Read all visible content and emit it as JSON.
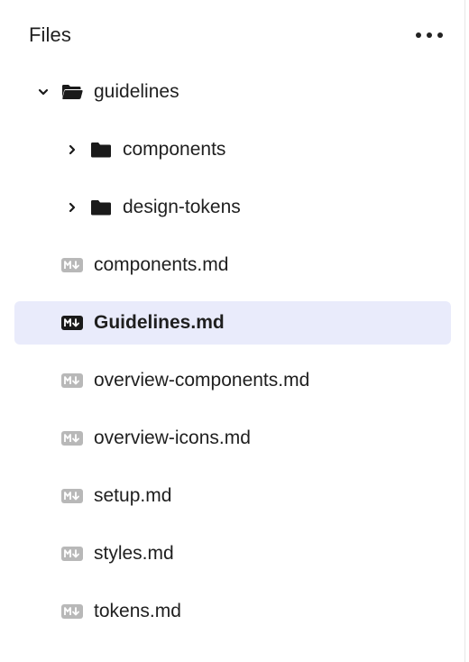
{
  "header": {
    "title": "Files",
    "more_icon": "more-horizontal-icon"
  },
  "tree": {
    "items": [
      {
        "type": "folder",
        "label": "guidelines",
        "expanded": true,
        "level": 0
      },
      {
        "type": "folder",
        "label": "components",
        "expanded": false,
        "level": 1
      },
      {
        "type": "folder",
        "label": "design-tokens",
        "expanded": false,
        "level": 1
      },
      {
        "type": "file",
        "label": "components.md",
        "level": 0,
        "selected": false
      },
      {
        "type": "file",
        "label": "Guidelines.md",
        "level": 0,
        "selected": true
      },
      {
        "type": "file",
        "label": "overview-components.md",
        "level": 0,
        "selected": false
      },
      {
        "type": "file",
        "label": "overview-icons.md",
        "level": 0,
        "selected": false
      },
      {
        "type": "file",
        "label": "setup.md",
        "level": 0,
        "selected": false
      },
      {
        "type": "file",
        "label": "styles.md",
        "level": 0,
        "selected": false
      },
      {
        "type": "file",
        "label": "tokens.md",
        "level": 0,
        "selected": false
      }
    ]
  },
  "colors": {
    "selected_background": "#e9ebfb",
    "file_icon_default": "#b8b8b8",
    "file_icon_selected": "#1a1a1a",
    "text": "#1f1f1f"
  }
}
